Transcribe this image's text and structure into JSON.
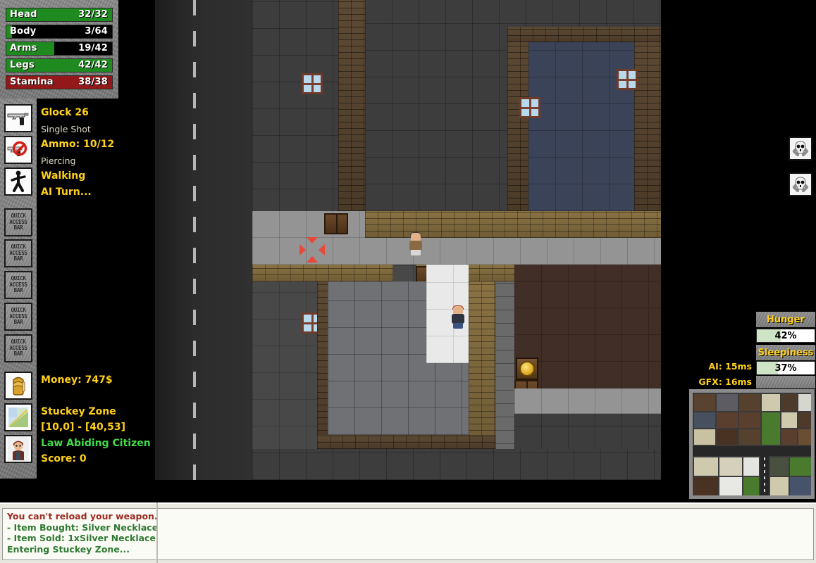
{
  "hud": {
    "vitals": [
      {
        "label": "Head",
        "value": "32/32",
        "pct": 100,
        "color": "#1f8a1f",
        "type": "health"
      },
      {
        "label": "Body",
        "value": "3/64",
        "pct": 5,
        "color": "#1f8a1f",
        "type": "health"
      },
      {
        "label": "Arms",
        "value": "19/42",
        "pct": 45,
        "color": "#1f8a1f",
        "type": "health"
      },
      {
        "label": "Legs",
        "value": "42/42",
        "pct": 100,
        "color": "#1f8a1f",
        "type": "health"
      },
      {
        "label": "Stamina",
        "value": "38/38",
        "pct": 100,
        "color": "#93181a",
        "type": "stamina"
      }
    ],
    "weapon": {
      "name": "Glock 26",
      "fire_mode": "Single Shot",
      "ammo": "Ammo: 10/12",
      "ammo_type": "Piercing",
      "weapon_icon": "pistol-icon",
      "ammo_icon": "no-reload-icon"
    },
    "movement": {
      "mode": "Walking",
      "turn_status": "AI Turn...",
      "icon": "walking-person-icon"
    },
    "quick_access": {
      "slot_label_lines": [
        "QUICK",
        "ACCESS",
        "BAR"
      ],
      "count": 5
    },
    "money": {
      "label": "Money: 747$",
      "icon": "backpack-icon"
    },
    "zone": {
      "name": "Stuckey Zone",
      "coords": "[10,0] - [40,53]",
      "icon": "map-icon"
    },
    "reputation": {
      "title": "Law Abiding Citizen",
      "score": "Score: 0",
      "color": "#3fdd49",
      "icon": "player-portrait-icon"
    }
  },
  "right_hud": {
    "enemies": [
      {
        "icon": "skull-icon"
      },
      {
        "icon": "skull-icon"
      }
    ],
    "needs": [
      {
        "label": "Hunger",
        "value": "42%",
        "pct": 42
      },
      {
        "label": "Sleepiness",
        "value": "37%",
        "pct": 37
      }
    ],
    "perf": [
      {
        "label": "AI: 15ms"
      },
      {
        "label": "GFX: 16ms"
      }
    ],
    "minimap": {
      "name": "minimap"
    }
  },
  "log": {
    "lines": [
      {
        "text": "You can't reload your weapon.",
        "color": "#9e2b22"
      },
      {
        "text": "- Item Bought: Silver Necklace",
        "color": "#2f7a32"
      },
      {
        "text": "- Item Sold: 1xSilver Necklace",
        "color": "#2f7a32"
      },
      {
        "text": "Entering Stuckey Zone...",
        "color": "#2f7a32"
      }
    ]
  },
  "map": {
    "player": {
      "name": "player-character",
      "hair": "#9e3326",
      "body": "#2d3440",
      "legs": "#3a5282"
    },
    "npcs": [
      {
        "name": "npc-citizen",
        "hair": "#3a3a3a",
        "body": "#8a6a42",
        "legs": "#d8d8d8"
      }
    ],
    "cursor": {
      "name": "targeting-cursor",
      "color": "#e8483a"
    },
    "shop_sign": {
      "name": "shop-coin-sign"
    }
  },
  "colors": {
    "accent_yellow": "#ffd11a",
    "health_green": "#1f8a1f",
    "stamina_red": "#93181a",
    "rep_green": "#3fdd49",
    "log_error": "#9e2b22",
    "log_ok": "#2f7a32"
  }
}
